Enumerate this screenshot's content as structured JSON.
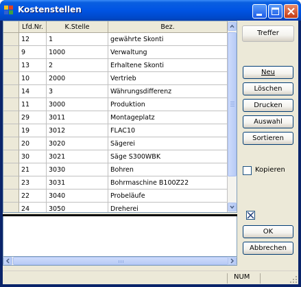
{
  "window": {
    "title": "Kostenstellen",
    "icon": "application-grid-icon"
  },
  "grid": {
    "columns": [
      "Lfd.Nr.",
      "K.Stelle",
      "Bez."
    ],
    "rows": [
      {
        "lfd": "12",
        "kst": "1",
        "bez": "gewährte Skonti"
      },
      {
        "lfd": "9",
        "kst": "1000",
        "bez": "Verwaltung"
      },
      {
        "lfd": "13",
        "kst": "2",
        "bez": "Erhaltene Skonti"
      },
      {
        "lfd": "10",
        "kst": "2000",
        "bez": "Vertrieb"
      },
      {
        "lfd": "14",
        "kst": "3",
        "bez": "Währungsdifferenz"
      },
      {
        "lfd": "11",
        "kst": "3000",
        "bez": "Produktion"
      },
      {
        "lfd": "29",
        "kst": "3011",
        "bez": "Montageplatz"
      },
      {
        "lfd": "19",
        "kst": "3012",
        "bez": "FLAC10"
      },
      {
        "lfd": "20",
        "kst": "3020",
        "bez": "Sägerei"
      },
      {
        "lfd": "30",
        "kst": "3021",
        "bez": "Säge S300WBK"
      },
      {
        "lfd": "21",
        "kst": "3030",
        "bez": "Bohren"
      },
      {
        "lfd": "23",
        "kst": "3031",
        "bez": "Bohrmaschine B100Z22"
      },
      {
        "lfd": "22",
        "kst": "3040",
        "bez": "Probeläufe"
      },
      {
        "lfd": "24",
        "kst": "3050",
        "bez": "Dreherei"
      }
    ]
  },
  "buttons": {
    "treffer": "Treffer",
    "neu": "Neu",
    "loeschen": "Löschen",
    "drucken": "Drucken",
    "auswahl": "Auswahl",
    "sortieren": "Sortieren",
    "ok": "OK",
    "abbrechen": "Abbrechen"
  },
  "options": {
    "kopieren_label": "Kopieren",
    "kopieren_checked": false,
    "close_checked": true
  },
  "status": {
    "num": "NUM"
  }
}
